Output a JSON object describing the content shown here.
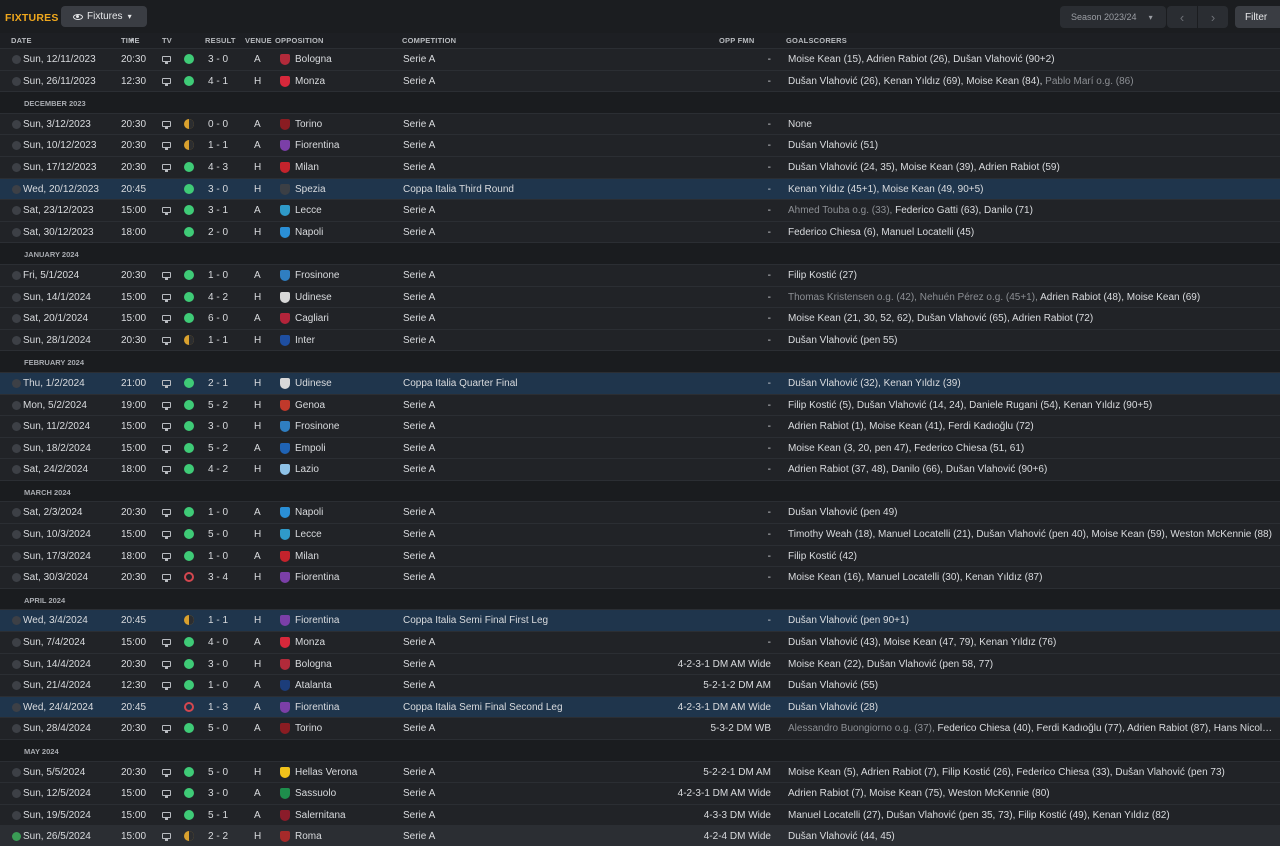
{
  "header": {
    "title": "FIXTURES",
    "view_label": "Fixtures",
    "season_label": "Season 2023/24",
    "filter_label": "Filter"
  },
  "columns": {
    "date": "DATE",
    "time": "TIME",
    "tv": "TV",
    "result": "RESULT",
    "venue": "VENUE",
    "opposition": "OPPOSITION",
    "competition": "COMPETITION",
    "opp_fmn": "OPP FMN",
    "goalscorers": "GOALSCORERS"
  },
  "colors": {
    "win": "#3fcb77",
    "draw": "#d9a12e",
    "loss": "#d4474f",
    "accent": "#f0a81d",
    "cup_row": "#1f354c"
  },
  "rows": [
    {
      "type": "match",
      "date": "Sun, 12/11/2023",
      "time": "20:30",
      "tv": true,
      "result": "W",
      "score": "3 - 0",
      "venue": "A",
      "opponent": "Bologna",
      "crest": "#b22a3a",
      "competition": "Serie A",
      "opp_fmn": "-",
      "scorers": [
        {
          "t": "Moise Kean (15), Adrien Rabiot (26), Dušan Vlahović (90+2)",
          "og": false
        }
      ]
    },
    {
      "type": "match",
      "date": "Sun, 26/11/2023",
      "time": "12:30",
      "tv": true,
      "result": "W",
      "score": "4 - 1",
      "venue": "H",
      "opponent": "Monza",
      "crest": "#d7283b",
      "competition": "Serie A",
      "opp_fmn": "-",
      "scorers": [
        {
          "t": "Dušan Vlahović (26), Kenan Yıldız (69), Moise Kean (84), ",
          "og": false
        },
        {
          "t": "Pablo Marí o.g. (86)",
          "og": true
        }
      ]
    },
    {
      "type": "month",
      "label": "DECEMBER 2023"
    },
    {
      "type": "match",
      "date": "Sun, 3/12/2023",
      "time": "20:30",
      "tv": true,
      "result": "D",
      "score": "0 - 0",
      "venue": "A",
      "opponent": "Torino",
      "crest": "#8a1c22",
      "competition": "Serie A",
      "opp_fmn": "-",
      "scorers": [
        {
          "t": "None",
          "og": false
        }
      ]
    },
    {
      "type": "match",
      "date": "Sun, 10/12/2023",
      "time": "20:30",
      "tv": true,
      "result": "D",
      "score": "1 - 1",
      "venue": "A",
      "opponent": "Fiorentina",
      "crest": "#7b3fa8",
      "competition": "Serie A",
      "opp_fmn": "-",
      "scorers": [
        {
          "t": "Dušan Vlahović (51)",
          "og": false
        }
      ]
    },
    {
      "type": "match",
      "date": "Sun, 17/12/2023",
      "time": "20:30",
      "tv": true,
      "result": "W",
      "score": "4 - 3",
      "venue": "H",
      "opponent": "Milan",
      "crest": "#c4232c",
      "competition": "Serie A",
      "opp_fmn": "-",
      "scorers": [
        {
          "t": "Dušan Vlahović (24, 35), Moise Kean (39), Adrien Rabiot (59)",
          "og": false
        }
      ]
    },
    {
      "type": "match",
      "cup": true,
      "date": "Wed, 20/12/2023",
      "time": "20:45",
      "tv": false,
      "result": "W",
      "score": "3 - 0",
      "venue": "H",
      "opponent": "Spezia",
      "crest": "#3b3f45",
      "competition": "Coppa Italia Third Round",
      "opp_fmn": "-",
      "scorers": [
        {
          "t": "Kenan Yıldız (45+1), Moise Kean (49, 90+5)",
          "og": false
        }
      ]
    },
    {
      "type": "match",
      "date": "Sat, 23/12/2023",
      "time": "15:00",
      "tv": true,
      "result": "W",
      "score": "3 - 1",
      "venue": "A",
      "opponent": "Lecce",
      "crest": "#2f9ac9",
      "competition": "Serie A",
      "opp_fmn": "-",
      "scorers": [
        {
          "t": "Ahmed Touba o.g. (33), ",
          "og": true
        },
        {
          "t": "Federico Gatti (63), Danilo (71)",
          "og": false
        }
      ]
    },
    {
      "type": "match",
      "date": "Sat, 30/12/2023",
      "time": "18:00",
      "tv": false,
      "result": "W",
      "score": "2 - 0",
      "venue": "H",
      "opponent": "Napoli",
      "crest": "#2a8fd6",
      "competition": "Serie A",
      "opp_fmn": "-",
      "scorers": [
        {
          "t": "Federico Chiesa (6), Manuel Locatelli (45)",
          "og": false
        }
      ]
    },
    {
      "type": "month",
      "label": "JANUARY 2024"
    },
    {
      "type": "match",
      "date": "Fri, 5/1/2024",
      "time": "20:30",
      "tv": true,
      "result": "W",
      "score": "1 - 0",
      "venue": "A",
      "opponent": "Frosinone",
      "crest": "#2f7ec1",
      "competition": "Serie A",
      "opp_fmn": "-",
      "scorers": [
        {
          "t": "Filip Kostić (27)",
          "og": false
        }
      ]
    },
    {
      "type": "match",
      "date": "Sun, 14/1/2024",
      "time": "15:00",
      "tv": true,
      "result": "W",
      "score": "4 - 2",
      "venue": "H",
      "opponent": "Udinese",
      "crest": "#d8d8d8",
      "competition": "Serie A",
      "opp_fmn": "-",
      "scorers": [
        {
          "t": "Thomas Kristensen o.g. (42), Nehuén Pérez o.g. (45+1), ",
          "og": true
        },
        {
          "t": "Adrien Rabiot (48), Moise Kean (69)",
          "og": false
        }
      ]
    },
    {
      "type": "match",
      "date": "Sat, 20/1/2024",
      "time": "15:00",
      "tv": true,
      "result": "W",
      "score": "6 - 0",
      "venue": "A",
      "opponent": "Cagliari",
      "crest": "#b3243a",
      "competition": "Serie A",
      "opp_fmn": "-",
      "scorers": [
        {
          "t": "Moise Kean (21, 30, 52, 62), Dušan Vlahović (65), Adrien Rabiot (72)",
          "og": false
        }
      ]
    },
    {
      "type": "match",
      "date": "Sun, 28/1/2024",
      "time": "20:30",
      "tv": true,
      "result": "D",
      "score": "1 - 1",
      "venue": "H",
      "opponent": "Inter",
      "crest": "#1e4ea0",
      "competition": "Serie A",
      "opp_fmn": "-",
      "scorers": [
        {
          "t": "Dušan Vlahović (pen 55)",
          "og": false
        }
      ]
    },
    {
      "type": "month",
      "label": "FEBRUARY 2024"
    },
    {
      "type": "match",
      "cup": true,
      "date": "Thu, 1/2/2024",
      "time": "21:00",
      "tv": true,
      "result": "W",
      "score": "2 - 1",
      "venue": "H",
      "opponent": "Udinese",
      "crest": "#d8d8d8",
      "competition": "Coppa Italia Quarter Final",
      "opp_fmn": "-",
      "scorers": [
        {
          "t": "Dušan Vlahović (32), Kenan Yıldız (39)",
          "og": false
        }
      ]
    },
    {
      "type": "match",
      "date": "Mon, 5/2/2024",
      "time": "19:00",
      "tv": true,
      "result": "W",
      "score": "5 - 2",
      "venue": "H",
      "opponent": "Genoa",
      "crest": "#c0392b",
      "competition": "Serie A",
      "opp_fmn": "-",
      "scorers": [
        {
          "t": "Filip Kostić (5), Dušan Vlahović (14, 24), Daniele Rugani (54), Kenan Yıldız (90+5)",
          "og": false
        }
      ]
    },
    {
      "type": "match",
      "date": "Sun, 11/2/2024",
      "time": "15:00",
      "tv": true,
      "result": "W",
      "score": "3 - 0",
      "venue": "H",
      "opponent": "Frosinone",
      "crest": "#2f7ec1",
      "competition": "Serie A",
      "opp_fmn": "-",
      "scorers": [
        {
          "t": "Adrien Rabiot (1), Moise Kean (41), Ferdi Kadıoğlu (72)",
          "og": false
        }
      ]
    },
    {
      "type": "match",
      "date": "Sun, 18/2/2024",
      "time": "15:00",
      "tv": true,
      "result": "W",
      "score": "5 - 2",
      "venue": "A",
      "opponent": "Empoli",
      "crest": "#1f63b5",
      "competition": "Serie A",
      "opp_fmn": "-",
      "scorers": [
        {
          "t": "Moise Kean (3, 20, pen 47), Federico Chiesa (51, 61)",
          "og": false
        }
      ]
    },
    {
      "type": "match",
      "date": "Sat, 24/2/2024",
      "time": "18:00",
      "tv": true,
      "result": "W",
      "score": "4 - 2",
      "venue": "H",
      "opponent": "Lazio",
      "crest": "#8fc3e8",
      "competition": "Serie A",
      "opp_fmn": "-",
      "scorers": [
        {
          "t": "Adrien Rabiot (37, 48), Danilo (66), Dušan Vlahović (90+6)",
          "og": false
        }
      ]
    },
    {
      "type": "month",
      "label": "MARCH 2024"
    },
    {
      "type": "match",
      "date": "Sat, 2/3/2024",
      "time": "20:30",
      "tv": true,
      "result": "W",
      "score": "1 - 0",
      "venue": "A",
      "opponent": "Napoli",
      "crest": "#2a8fd6",
      "competition": "Serie A",
      "opp_fmn": "-",
      "scorers": [
        {
          "t": "Dušan Vlahović (pen 49)",
          "og": false
        }
      ]
    },
    {
      "type": "match",
      "date": "Sun, 10/3/2024",
      "time": "15:00",
      "tv": true,
      "result": "W",
      "score": "5 - 0",
      "venue": "H",
      "opponent": "Lecce",
      "crest": "#2f9ac9",
      "competition": "Serie A",
      "opp_fmn": "-",
      "scorers": [
        {
          "t": "Timothy Weah (18), Manuel Locatelli (21), Dušan Vlahović (pen 40), Moise Kean (59), Weston McKennie (88)",
          "og": false
        }
      ]
    },
    {
      "type": "match",
      "date": "Sun, 17/3/2024",
      "time": "18:00",
      "tv": true,
      "result": "W",
      "score": "1 - 0",
      "venue": "A",
      "opponent": "Milan",
      "crest": "#c4232c",
      "competition": "Serie A",
      "opp_fmn": "-",
      "scorers": [
        {
          "t": "Filip Kostić (42)",
          "og": false
        }
      ]
    },
    {
      "type": "match",
      "date": "Sat, 30/3/2024",
      "time": "20:30",
      "tv": true,
      "result": "L",
      "score": "3 - 4",
      "venue": "H",
      "opponent": "Fiorentina",
      "crest": "#7b3fa8",
      "competition": "Serie A",
      "opp_fmn": "-",
      "scorers": [
        {
          "t": "Moise Kean (16), Manuel Locatelli (30), Kenan Yıldız (87)",
          "og": false
        }
      ]
    },
    {
      "type": "month",
      "label": "APRIL 2024"
    },
    {
      "type": "match",
      "cup": true,
      "date": "Wed, 3/4/2024",
      "time": "20:45",
      "tv": false,
      "result": "D",
      "score": "1 - 1",
      "venue": "H",
      "opponent": "Fiorentina",
      "crest": "#7b3fa8",
      "competition": "Coppa Italia Semi Final First Leg",
      "opp_fmn": "-",
      "scorers": [
        {
          "t": "Dušan Vlahović (pen 90+1)",
          "og": false
        }
      ]
    },
    {
      "type": "match",
      "date": "Sun, 7/4/2024",
      "time": "15:00",
      "tv": true,
      "result": "W",
      "score": "4 - 0",
      "venue": "A",
      "opponent": "Monza",
      "crest": "#d7283b",
      "competition": "Serie A",
      "opp_fmn": "-",
      "scorers": [
        {
          "t": "Dušan Vlahović (43), Moise Kean (47, 79), Kenan Yıldız (76)",
          "og": false
        }
      ]
    },
    {
      "type": "match",
      "date": "Sun, 14/4/2024",
      "time": "20:30",
      "tv": true,
      "result": "W",
      "score": "3 - 0",
      "venue": "H",
      "opponent": "Bologna",
      "crest": "#b22a3a",
      "competition": "Serie A",
      "opp_fmn": "4-2-3-1 DM AM Wide",
      "scorers": [
        {
          "t": "Moise Kean (22), Dušan Vlahović (pen 58, 77)",
          "og": false
        }
      ]
    },
    {
      "type": "match",
      "date": "Sun, 21/4/2024",
      "time": "12:30",
      "tv": true,
      "result": "W",
      "score": "1 - 0",
      "venue": "A",
      "opponent": "Atalanta",
      "crest": "#1c3d7a",
      "competition": "Serie A",
      "opp_fmn": "5-2-1-2 DM AM",
      "scorers": [
        {
          "t": "Dušan Vlahović (55)",
          "og": false
        }
      ]
    },
    {
      "type": "match",
      "cup": true,
      "date": "Wed, 24/4/2024",
      "time": "20:45",
      "tv": false,
      "result": "L",
      "score": "1 - 3",
      "venue": "A",
      "opponent": "Fiorentina",
      "crest": "#7b3fa8",
      "competition": "Coppa Italia Semi Final Second Leg",
      "opp_fmn": "4-2-3-1 DM AM Wide",
      "scorers": [
        {
          "t": "Dušan Vlahović (28)",
          "og": false
        }
      ]
    },
    {
      "type": "match",
      "date": "Sun, 28/4/2024",
      "time": "20:30",
      "tv": true,
      "result": "W",
      "score": "5 - 0",
      "venue": "A",
      "opponent": "Torino",
      "crest": "#8a1c22",
      "competition": "Serie A",
      "opp_fmn": "5-3-2 DM WB",
      "scorers": [
        {
          "t": "Alessandro Buongiorno o.g. (37), ",
          "og": true
        },
        {
          "t": "Federico Chiesa (40), Ferdi Kadıoğlu (77), Adrien Rabiot (87), Hans Nicolussi...",
          "og": false
        }
      ]
    },
    {
      "type": "month",
      "label": "MAY 2024"
    },
    {
      "type": "match",
      "date": "Sun, 5/5/2024",
      "time": "20:30",
      "tv": true,
      "result": "W",
      "score": "5 - 0",
      "venue": "H",
      "opponent": "Hellas Verona",
      "crest": "#f1c21b",
      "competition": "Serie A",
      "opp_fmn": "5-2-2-1 DM AM",
      "scorers": [
        {
          "t": "Moise Kean (5), Adrien Rabiot (7), Filip Kostić (26), Federico Chiesa (33), Dušan Vlahović (pen 73)",
          "og": false
        }
      ]
    },
    {
      "type": "match",
      "date": "Sun, 12/5/2024",
      "time": "15:00",
      "tv": true,
      "result": "W",
      "score": "3 - 0",
      "venue": "A",
      "opponent": "Sassuolo",
      "crest": "#1e8e4c",
      "competition": "Serie A",
      "opp_fmn": "4-2-3-1 DM AM Wide",
      "scorers": [
        {
          "t": "Adrien Rabiot (7), Moise Kean (75), Weston McKennie (80)",
          "og": false
        }
      ]
    },
    {
      "type": "match",
      "date": "Sun, 19/5/2024",
      "time": "15:00",
      "tv": true,
      "result": "W",
      "score": "5 - 1",
      "venue": "A",
      "opponent": "Salernitana",
      "crest": "#8b1c2a",
      "competition": "Serie A",
      "opp_fmn": "4-3-3 DM Wide",
      "scorers": [
        {
          "t": "Manuel Locatelli (27), Dušan Vlahović (pen 35, 73), Filip Kostić (49), Kenan Yıldız (82)",
          "og": false
        }
      ]
    },
    {
      "type": "match",
      "last": true,
      "date": "Sun, 26/5/2024",
      "time": "15:00",
      "tv": true,
      "result": "D",
      "score": "2 - 2",
      "venue": "H",
      "opponent": "Roma",
      "crest": "#a52a2a",
      "competition": "Serie A",
      "opp_fmn": "4-2-4 DM Wide",
      "scorers": [
        {
          "t": "Dušan Vlahović (44, 45)",
          "og": false
        }
      ]
    }
  ]
}
